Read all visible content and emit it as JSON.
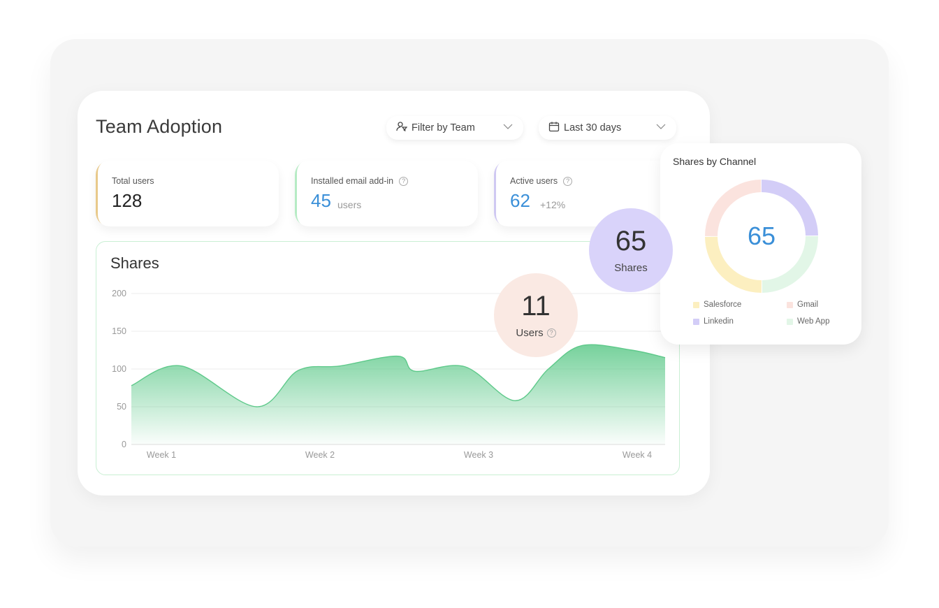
{
  "page_title": "Team Adoption",
  "filters": {
    "team_label": "Filter by Team",
    "date_label": "Last 30 days"
  },
  "stats": {
    "total": {
      "label": "Total users",
      "value": "128"
    },
    "email": {
      "label": "Installed email add-in",
      "value": "45",
      "unit": "users"
    },
    "active": {
      "label": "Active users",
      "value": "62",
      "change": "+12%"
    }
  },
  "shares": {
    "title": "Shares"
  },
  "chart_data": {
    "type": "area",
    "title": "Shares",
    "xlabel": "",
    "ylabel": "",
    "categories": [
      "Week 1",
      "Week 2",
      "Week 3",
      "Week 4"
    ],
    "ylim": [
      0,
      200
    ],
    "yticks": [
      0,
      50,
      100,
      150,
      200
    ],
    "grid": true,
    "x": [
      0,
      0.6,
      1.5,
      2.0,
      2.5,
      3.2,
      3.4,
      4.0,
      4.6,
      5.0,
      5.4,
      6.0,
      6.4
    ],
    "y": [
      78,
      104,
      50,
      98,
      104,
      117,
      97,
      103,
      58,
      100,
      131,
      125,
      115
    ],
    "color": "#5ec98a"
  },
  "bubbles": {
    "users": {
      "value": "11",
      "label": "Users"
    },
    "shares": {
      "value": "65",
      "label": "Shares"
    }
  },
  "channels": {
    "title": "Shares by Channel",
    "total": "65",
    "legend": [
      {
        "label": "Salesforce",
        "color": "#fcefc0"
      },
      {
        "label": "Gmail",
        "color": "#fbe3de"
      },
      {
        "label": "Linkedin",
        "color": "#d3cdf7"
      },
      {
        "label": "Web App",
        "color": "#e2f6e7"
      }
    ]
  },
  "colors": {
    "accent_blue": "#3a8fd8",
    "chart_green": "#5ec98a",
    "total_accent": "#e8c98a",
    "email_accent": "#b6ebc4",
    "active_accent": "#cfc8f2"
  }
}
